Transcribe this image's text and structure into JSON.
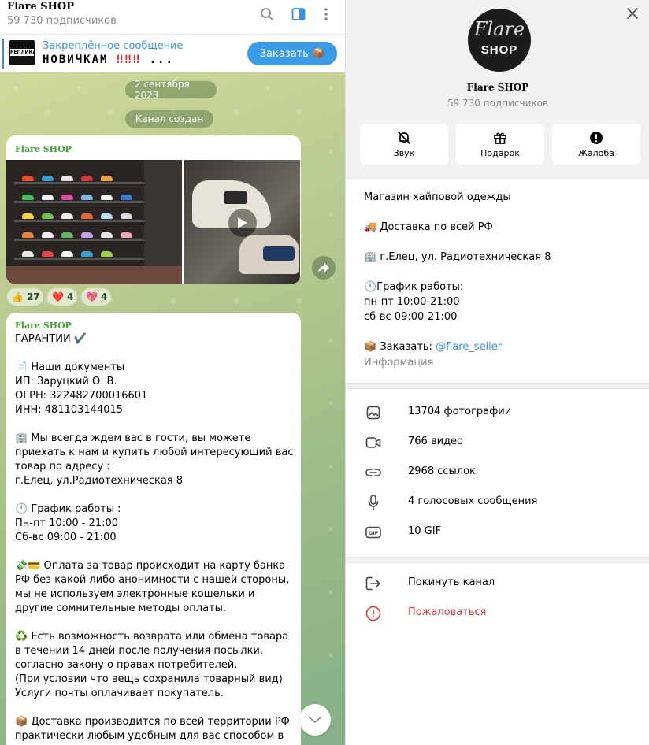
{
  "chat": {
    "title": "Flare SHOP",
    "subscribers": "59 730 подписчиков",
    "icons": [
      "search-icon",
      "sidebar-toggle-icon",
      "more-vertical-icon"
    ],
    "pinned": {
      "title": "Закреплённое сообщение",
      "thumb_label": "РЕПЛИКА",
      "text": "НОВИЧКАМ",
      "marks": "‼‼‼",
      "ellipsis": "...",
      "order_button": "Заказать 📦"
    },
    "date_pill": "2 сентября 2023",
    "created_pill": "Канал создан",
    "post1": {
      "author": "Flare SHOP",
      "reactions": [
        {
          "emoji": "👍",
          "count": "27"
        },
        {
          "emoji": "❤️",
          "count": "4"
        },
        {
          "emoji": "💖",
          "count": "4"
        }
      ]
    },
    "post2": {
      "author": "Flare SHOP",
      "body": "ГАРАНТИИ ✔️\n\n📄 Наши документы\nИП: Заруцкий О. В.\nОГРН: 322482700016601\nИНН: 481103144015\n\n🏢 Мы всегда ждем вас в гости, вы можете приехать к нам и купить любой интересующий вас товар по адресу :\nг.Елец, ул.Радиотехническая 8\n\n🕛 График работы :\nПн-пт 10:00 - 21:00\nСб-вс 09:00 - 21:00\n\n💸💳 Оплата за товар происходит на карту банка РФ без какой либо анонимности с нашей стороны, мы не используем электронные кошельки и другие сомнительные методы оплаты.\n\n♻️ Есть возможность возврата или обмена товара в течении 14 дней после получения посылки, согласно закону о правах потребителей.\n(При условии что вещь сохранила товарный вид)\nУслуги почты оплачивает покупатель.\n\n📦 Доставка производится по всей территории РФ практически любым удобным для вас способом в день,"
    }
  },
  "profile": {
    "avatar_script": "Flare",
    "avatar_shop": "SHOP",
    "name": "Flare SHOP",
    "subscribers": "59 730 подписчиков",
    "actions": [
      {
        "label": "Звук",
        "icon": "bell-off-icon"
      },
      {
        "label": "Подарок",
        "icon": "gift-icon"
      },
      {
        "label": "Жалоба",
        "icon": "alert-icon"
      }
    ],
    "description": "Магазин хайповой одежды\n\n🚚 Доставка по всей  РФ\n\n🏢 г.Елец, ул. Радиотехническая 8\n\n🕛График работы:\nпн-пт 10:00-21:00\nсб-вс 09:00-21:00\n\n",
    "order_prefix": "📦 Заказать: ",
    "order_link": "@flare_seller",
    "info_label": "Информация",
    "media": [
      {
        "label": "13704 фотографии",
        "icon": "photo-icon"
      },
      {
        "label": "766 видео",
        "icon": "video-icon"
      },
      {
        "label": "2968 ссылок",
        "icon": "link-icon"
      },
      {
        "label": "4 голосовых сообщения",
        "icon": "microphone-icon"
      },
      {
        "label": "10 GIF",
        "icon": "gif-icon"
      }
    ],
    "leave": {
      "label": "Покинуть канал",
      "icon": "leave-icon"
    },
    "report": {
      "label": "Пожаловаться",
      "icon": "report-icon"
    },
    "colors": {
      "accent": "#3390ec",
      "danger": "#e53935",
      "author": "#3ea531"
    }
  }
}
